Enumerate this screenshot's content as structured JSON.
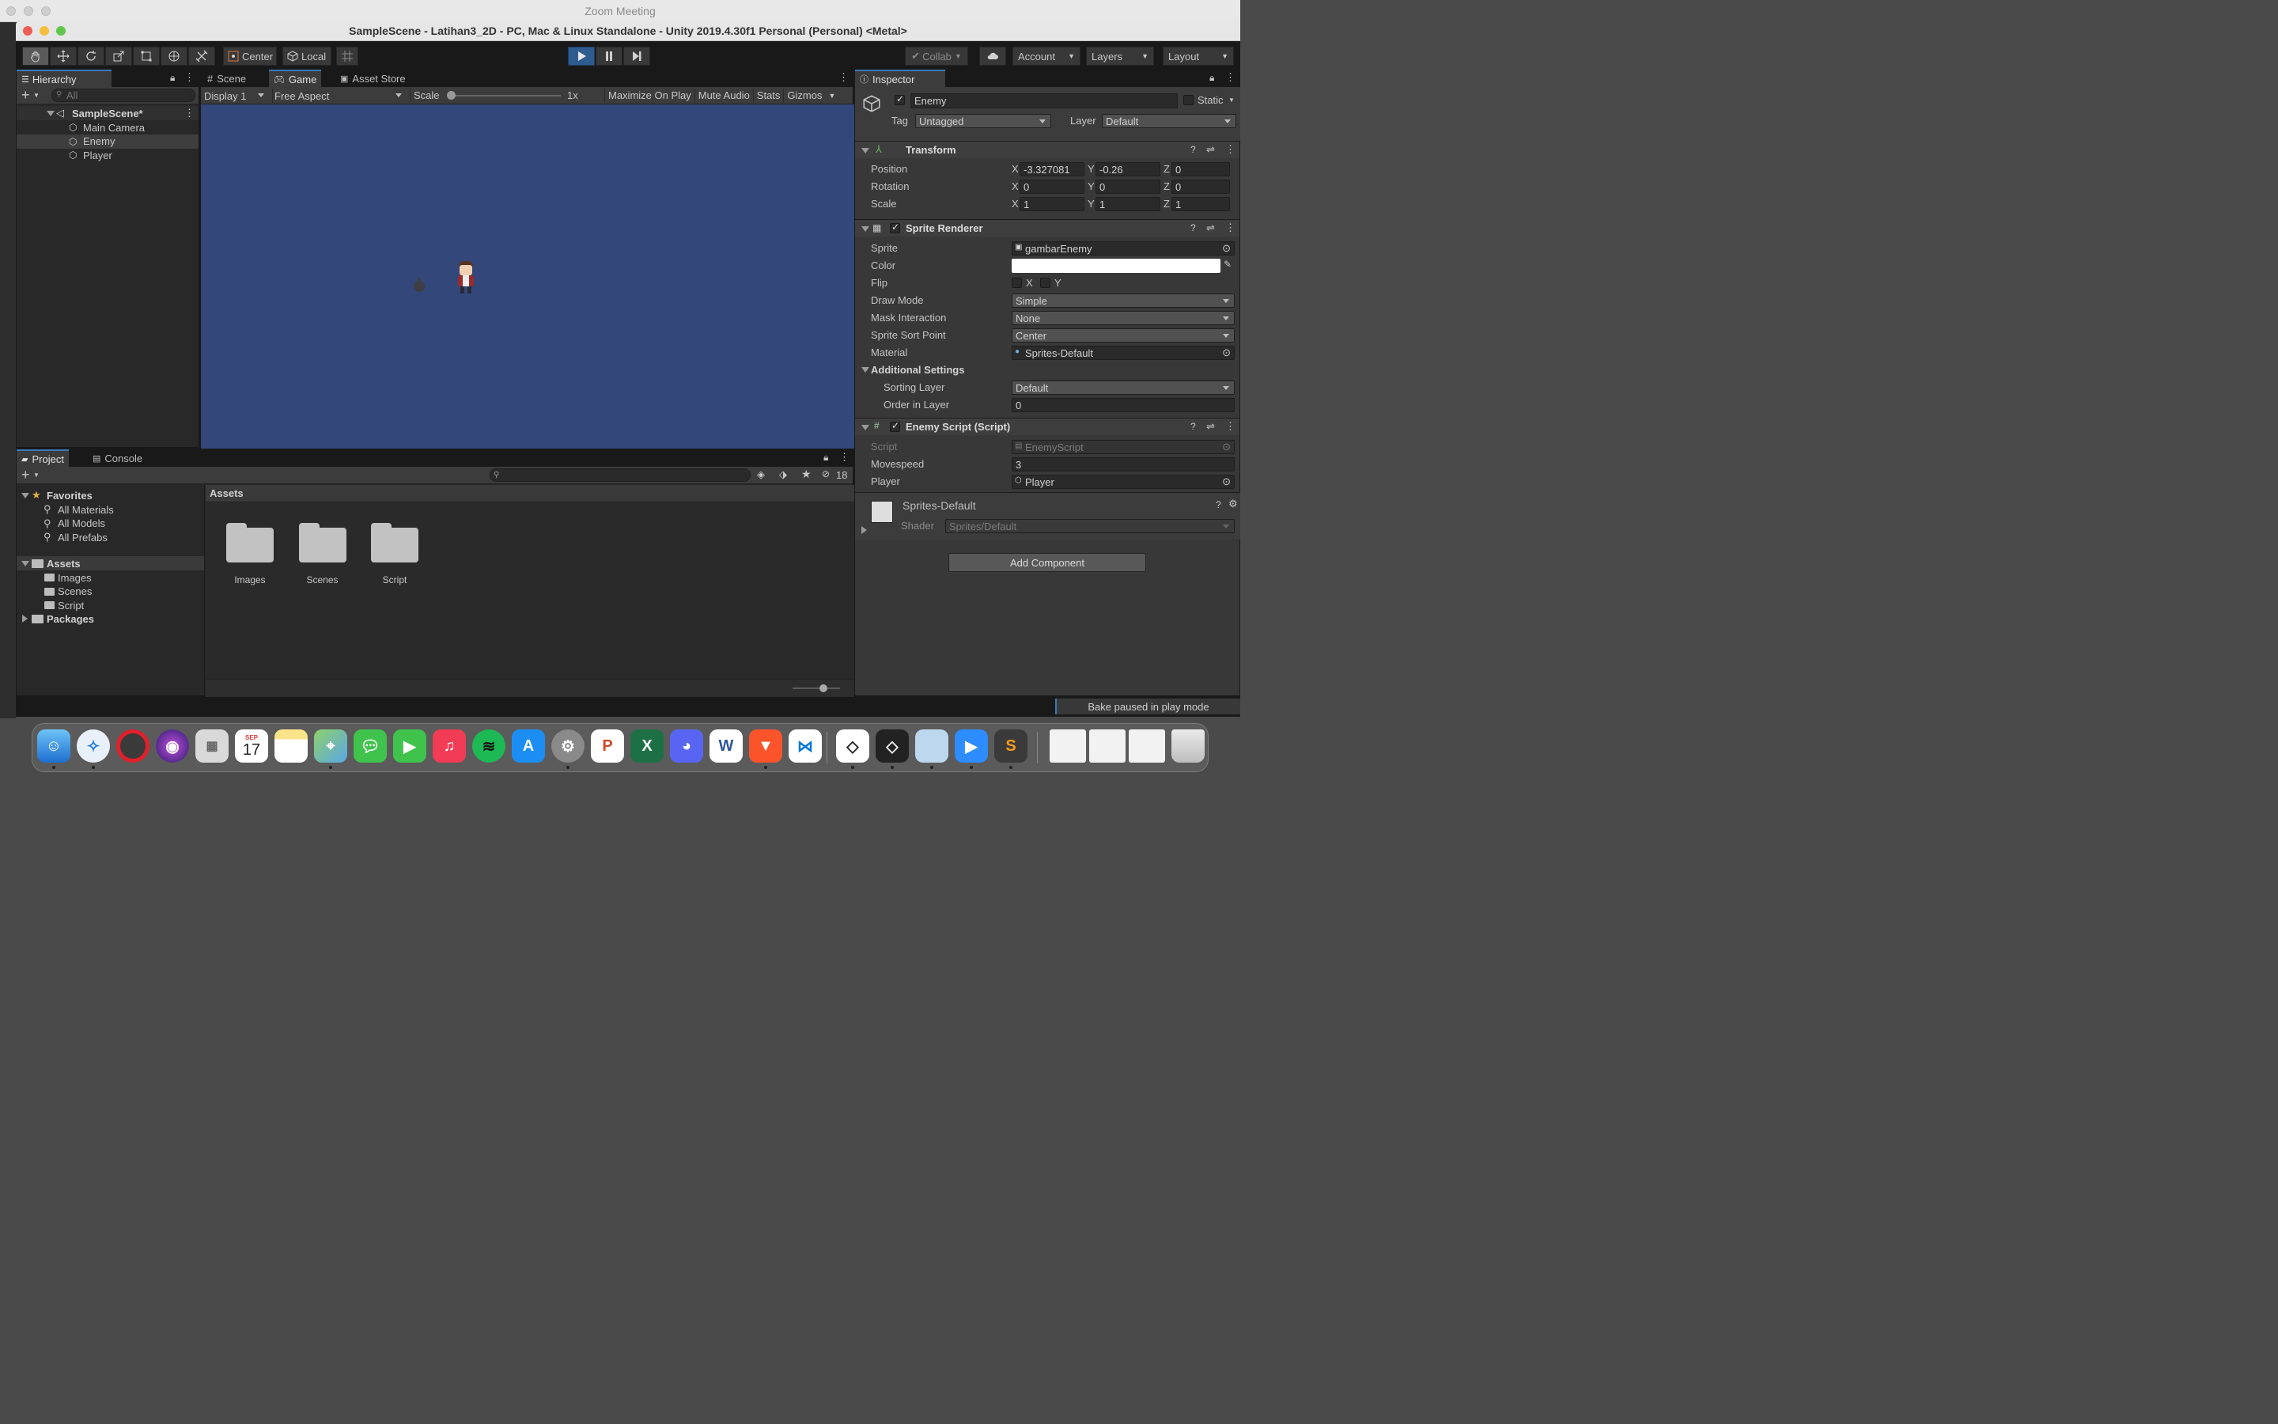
{
  "zoom_window": {
    "title": "Zoom Meeting"
  },
  "window": {
    "title": "SampleScene - Latihan3_2D - PC, Mac & Linux Standalone - Unity 2019.4.30f1 Personal (Personal) <Metal>"
  },
  "toolbar": {
    "pivot_label": "Center",
    "space_label": "Local",
    "collab_label": "Collab",
    "account_label": "Account",
    "layers_label": "Layers",
    "layout_label": "Layout"
  },
  "hierarchy": {
    "tab": "Hierarchy",
    "search_placeholder": "All",
    "scene": "SampleScene*",
    "items": [
      "Main Camera",
      "Enemy",
      "Player"
    ],
    "selected": "Enemy"
  },
  "game": {
    "tabs": [
      "Scene",
      "Game",
      "Asset Store"
    ],
    "active_tab": "Game",
    "display": "Display 1",
    "aspect": "Free Aspect",
    "scale_label": "Scale",
    "scale_value": "1x",
    "buttons": [
      "Maximize On Play",
      "Mute Audio",
      "Stats",
      "Gizmos"
    ],
    "background_color": "#33477a"
  },
  "project": {
    "tabs": [
      "Project",
      "Console"
    ],
    "hidden_count": "18",
    "favorites_label": "Favorites",
    "favorites": [
      "All Materials",
      "All Models",
      "All Prefabs"
    ],
    "assets_label": "Assets",
    "asset_folders": [
      "Images",
      "Scenes",
      "Script"
    ],
    "packages_label": "Packages",
    "breadcrumb": "Assets",
    "grid_items": [
      "Images",
      "Scenes",
      "Script"
    ]
  },
  "inspector": {
    "tab": "Inspector",
    "object_name": "Enemy",
    "static_label": "Static",
    "tag_label": "Tag",
    "tag_value": "Untagged",
    "layer_label": "Layer",
    "layer_value": "Default",
    "transform": {
      "title": "Transform",
      "position_label": "Position",
      "position": {
        "x": "-3.327081",
        "y": "-0.26",
        "z": "0"
      },
      "rotation_label": "Rotation",
      "rotation": {
        "x": "0",
        "y": "0",
        "z": "0"
      },
      "scale_label": "Scale",
      "scale": {
        "x": "1",
        "y": "1",
        "z": "1"
      },
      "axis_x": "X",
      "axis_y": "Y",
      "axis_z": "Z"
    },
    "sprite_renderer": {
      "title": "Sprite Renderer",
      "sprite_label": "Sprite",
      "sprite_value": "gambarEnemy",
      "color_label": "Color",
      "flip_label": "Flip",
      "flip_x": "X",
      "flip_y": "Y",
      "draw_mode_label": "Draw Mode",
      "draw_mode_value": "Simple",
      "mask_label": "Mask Interaction",
      "mask_value": "None",
      "sort_point_label": "Sprite Sort Point",
      "sort_point_value": "Center",
      "material_label": "Material",
      "material_value": "Sprites-Default",
      "additional_label": "Additional Settings",
      "sorting_layer_label": "Sorting Layer",
      "sorting_layer_value": "Default",
      "order_label": "Order in Layer",
      "order_value": "0"
    },
    "enemy_script": {
      "title": "Enemy Script (Script)",
      "script_label": "Script",
      "script_value": "EnemyScript",
      "movespeed_label": "Movespeed",
      "movespeed_value": "3",
      "player_label": "Player",
      "player_value": "Player"
    },
    "material": {
      "name": "Sprites-Default",
      "shader_label": "Shader",
      "shader_value": "Sprites/Default"
    },
    "add_component": "Add Component"
  },
  "status_bar": {
    "message": "Bake paused in play mode"
  },
  "dock": {
    "calendar_month": "SEP",
    "calendar_day": "17"
  }
}
